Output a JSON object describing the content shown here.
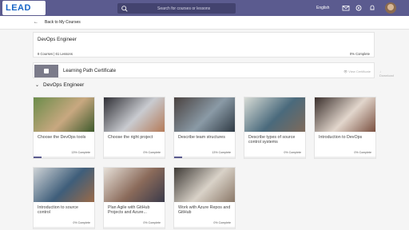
{
  "header": {
    "logo_text": "LEAD",
    "search_placeholder": "Search for courses or lessons",
    "language": "English",
    "icons": [
      "search-icon",
      "mail-icon",
      "settings-icon",
      "notification-icon"
    ]
  },
  "nav": {
    "back_label": "Back to My Courses"
  },
  "path": {
    "title": "DevOps Engineer",
    "stats": "8 Courses | 61 Lessons",
    "progress": "0% Complete"
  },
  "certificate": {
    "title": "Learning Path Certificate",
    "view_label": "View Certificate",
    "download_label": "Download"
  },
  "section": {
    "title": "DevOps Engineer"
  },
  "courses": [
    {
      "title": "Choose the DevOps tools",
      "progress": "13% Complete",
      "percent": 13,
      "colors": [
        "#6b8c4a",
        "#c8a880",
        "#3e5a2c"
      ]
    },
    {
      "title": "Choose the right project",
      "progress": "0% Complete",
      "percent": 0,
      "colors": [
        "#2f2f35",
        "#c9cbd0",
        "#b47a58"
      ]
    },
    {
      "title": "Describe team structures",
      "progress": "13% Complete",
      "percent": 13,
      "colors": [
        "#4a4240",
        "#8a9aa6",
        "#2f3a44"
      ]
    },
    {
      "title": "Describe types of source control systems",
      "progress": "0% Complete",
      "percent": 0,
      "colors": [
        "#d8dcd6",
        "#4a6a7c",
        "#7f6a5a"
      ]
    },
    {
      "title": "Introduction to DevOps",
      "progress": "0% Complete",
      "percent": 0,
      "colors": [
        "#3a2f2c",
        "#e2d6cc",
        "#7a5040"
      ]
    },
    {
      "title": "Introduction to source control",
      "progress": "0% Complete",
      "percent": 0,
      "colors": [
        "#cfd3d6",
        "#3f5e7a",
        "#9a6a48"
      ]
    },
    {
      "title": "Plan Agile with GitHub Projects and Azure...",
      "progress": "0% Complete",
      "percent": 0,
      "colors": [
        "#e6e0d8",
        "#8a6a5a",
        "#3a3a4a"
      ]
    },
    {
      "title": "Work with Azure Repos and GitHub",
      "progress": "0% Complete",
      "percent": 0,
      "colors": [
        "#3e3a36",
        "#d9d2c8",
        "#8a7868"
      ]
    }
  ]
}
